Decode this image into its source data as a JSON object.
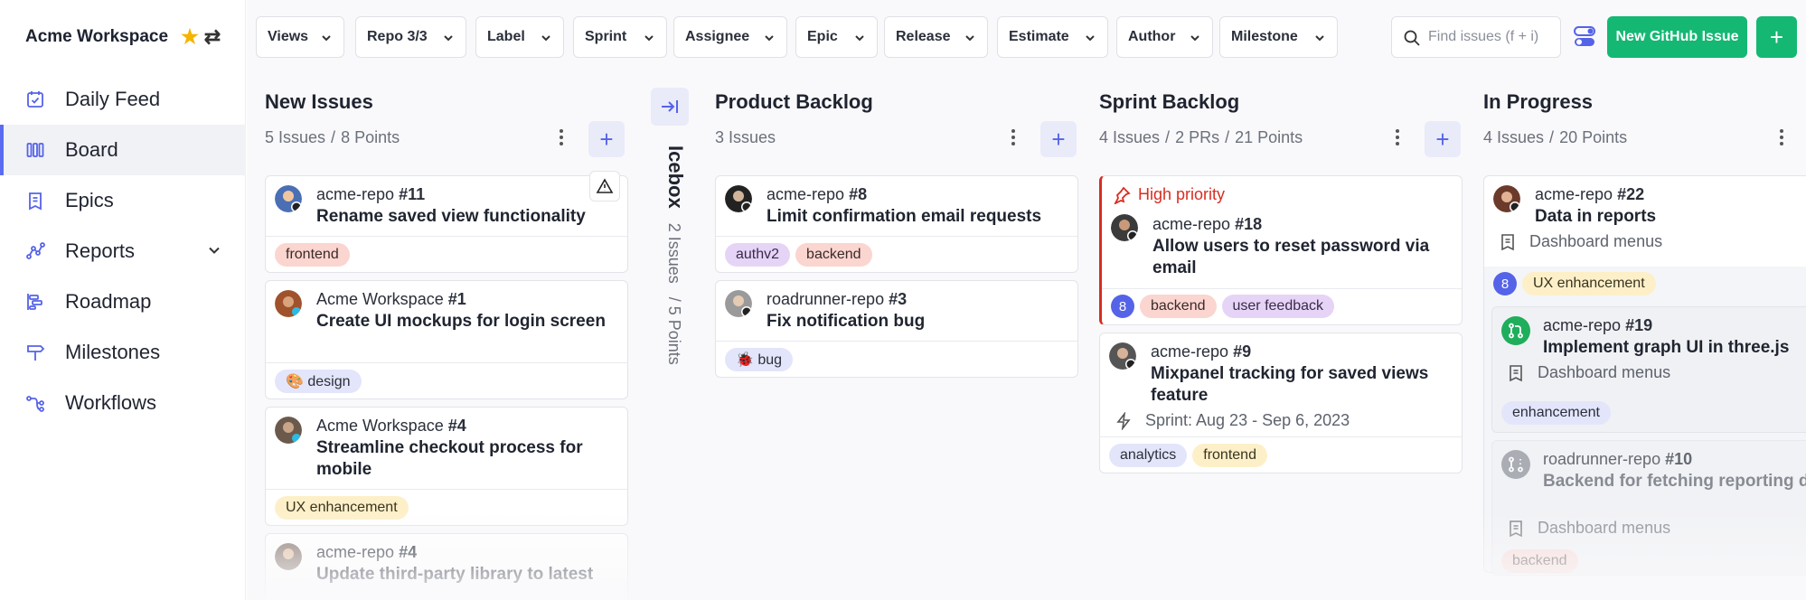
{
  "workspace": {
    "name": "Acme Workspace"
  },
  "nav": [
    {
      "label": "Daily Feed"
    },
    {
      "label": "Board"
    },
    {
      "label": "Epics"
    },
    {
      "label": "Reports"
    },
    {
      "label": "Roadmap"
    },
    {
      "label": "Milestones"
    },
    {
      "label": "Workflows"
    }
  ],
  "filters": [
    "Views",
    "Repo 3/3",
    "Label",
    "Sprint",
    "Assignee",
    "Epic",
    "Release",
    "Estimate",
    "Author",
    "Milestone"
  ],
  "search": {
    "placeholder": "Find issues (f + i)"
  },
  "new_issue_label": "New GitHub Issue",
  "icebox": {
    "title": "Icebox",
    "issues": "2 Issues",
    "points": "/ 5 Points"
  },
  "columns": {
    "new": {
      "title": "New Issues",
      "issues": "5 Issues",
      "points": "8 Points"
    },
    "product": {
      "title": "Product Backlog",
      "issues": "3 Issues"
    },
    "sprint": {
      "title": "Sprint Backlog",
      "issues": "4 Issues",
      "prs": "2 PRs",
      "points": "21 Points"
    },
    "progress": {
      "title": "In Progress",
      "issues": "4 Issues",
      "points": "20 Points"
    }
  },
  "cards": {
    "c11": {
      "repo": "acme-repo",
      "num": "#11",
      "title": "Rename saved view functionality",
      "tags": [
        "frontend"
      ]
    },
    "c1": {
      "repo": "Acme Workspace",
      "num": "#1",
      "title": "Create UI mockups for login screen",
      "tags": [
        "🎨 design"
      ]
    },
    "c4": {
      "repo": "Acme Workspace",
      "num": "#4",
      "title": "Streamline checkout process for mobile",
      "tags": [
        "UX enhancement"
      ]
    },
    "c4b": {
      "repo": "acme-repo",
      "num": "#4",
      "title": "Update third-party library to latest"
    },
    "c8": {
      "repo": "acme-repo",
      "num": "#8",
      "title": "Limit confirmation email requests",
      "tags": [
        "authv2",
        "backend"
      ]
    },
    "c3": {
      "repo": "roadrunner-repo",
      "num": "#3",
      "title": "Fix notification bug",
      "tags": [
        "🐞 bug"
      ]
    },
    "c18": {
      "priority": "High priority",
      "repo": "acme-repo",
      "num": "#18",
      "title": "Allow users to reset password via email",
      "estimate": "8",
      "tags": [
        "backend",
        "user feedback"
      ]
    },
    "c9": {
      "repo": "acme-repo",
      "num": "#9",
      "title": "Mixpanel tracking for saved views feature",
      "sprint": "Sprint: Aug 23 - Sep 6, 2023",
      "tags": [
        "analytics",
        "frontend"
      ]
    },
    "c22": {
      "repo": "acme-repo",
      "num": "#22",
      "title": "Data in reports",
      "epic": "Dashboard menus",
      "estimate": "8",
      "tags": [
        "UX enhancement"
      ]
    },
    "c19": {
      "repo": "acme-repo",
      "num": "#19",
      "title": "Implement graph UI in three.js",
      "epic": "Dashboard menus",
      "tags": [
        "enhancement"
      ]
    },
    "c10": {
      "repo": "roadrunner-repo",
      "num": "#10",
      "title": "Backend for fetching reporting data",
      "epic": "Dashboard menus",
      "tags": [
        "backend"
      ]
    }
  },
  "colors": {
    "accent": "#5563e8",
    "green": "#14b873",
    "priority": "#d92d20"
  }
}
